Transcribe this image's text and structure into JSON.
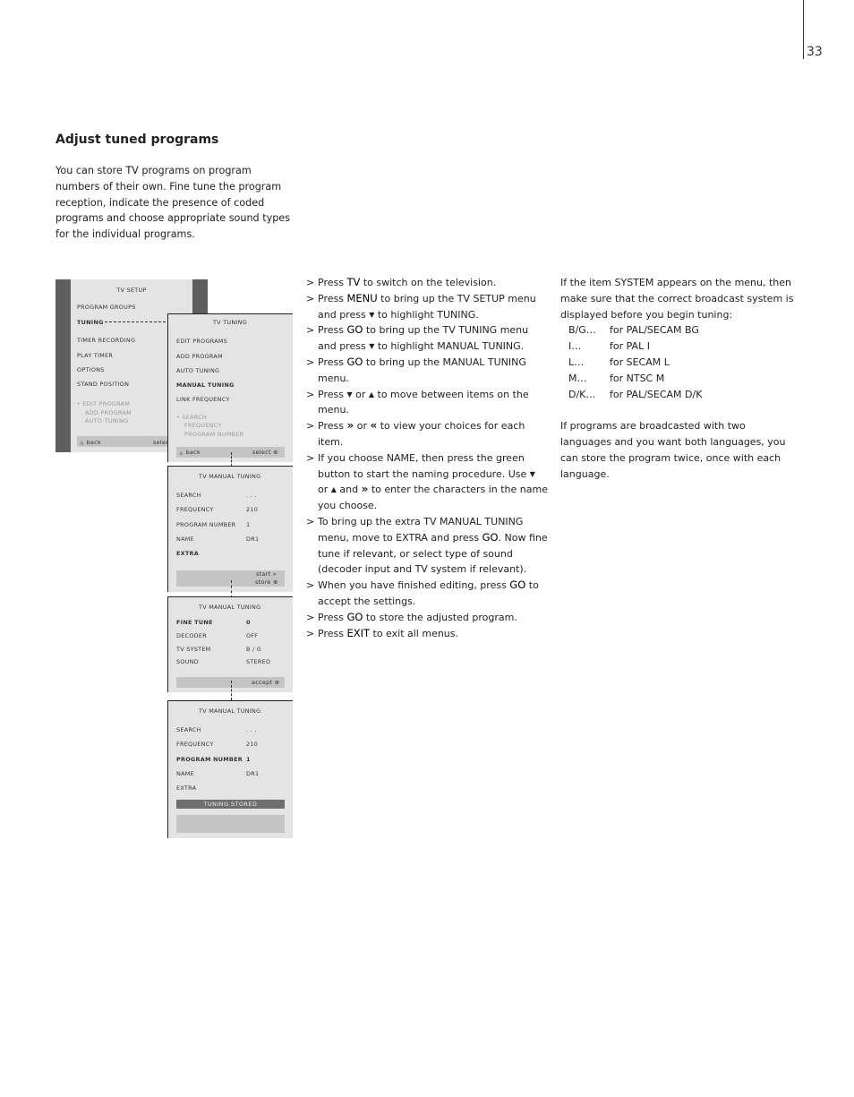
{
  "page_number": "33",
  "title": "Adjust tuned programs",
  "intro": "You can store TV programs on program numbers of their own. Fine tune the program reception, indicate the presence of coded programs and choose appropriate sound types for the individual programs.",
  "steps": [
    [
      {
        "t": "Press "
      },
      {
        "k": "TV"
      },
      {
        "t": " to switch on the television."
      }
    ],
    [
      {
        "t": "Press "
      },
      {
        "k": "MENU"
      },
      {
        "t": " to bring up the TV SETUP menu and press "
      },
      {
        "i": "down"
      },
      {
        "t": " to highlight TUNING."
      }
    ],
    [
      {
        "t": "Press "
      },
      {
        "k": "GO"
      },
      {
        "t": " to bring up the TV TUNING menu and press "
      },
      {
        "i": "down"
      },
      {
        "t": " to highlight MANUAL TUNING."
      }
    ],
    [
      {
        "t": "Press "
      },
      {
        "k": "GO"
      },
      {
        "t": " to bring up the MANUAL TUNING menu."
      }
    ],
    [
      {
        "t": "Press "
      },
      {
        "i": "down"
      },
      {
        "t": " or "
      },
      {
        "i": "up"
      },
      {
        "t": " to move between items on the menu."
      }
    ],
    [
      {
        "t": "Press "
      },
      {
        "i": "ff"
      },
      {
        "t": " or "
      },
      {
        "i": "rew"
      },
      {
        "t": " to view your choices for each item."
      }
    ],
    [
      {
        "t": "If you choose NAME, then press the green button to start the naming procedure. Use "
      },
      {
        "i": "down"
      },
      {
        "t": " or "
      },
      {
        "i": "up"
      },
      {
        "t": " and "
      },
      {
        "i": "ff"
      },
      {
        "t": " to enter the characters in the name you choose."
      }
    ],
    [
      {
        "t": "To bring up the extra TV MANUAL TUNING menu, move to EXTRA and press "
      },
      {
        "k": "GO"
      },
      {
        "t": ". Now fine tune if relevant, or select type of sound (decoder input and TV system if relevant)."
      }
    ],
    [
      {
        "t": "When you have finished editing, press "
      },
      {
        "k": "GO"
      },
      {
        "t": " to accept the settings."
      }
    ],
    [
      {
        "t": "Press "
      },
      {
        "k": "GO"
      },
      {
        "t": " to store the adjusted program."
      }
    ],
    [
      {
        "t": "Press "
      },
      {
        "k": "EXIT"
      },
      {
        "t": " to exit all menus."
      }
    ]
  ],
  "system_note": "If the item SYSTEM appears on the menu, then make sure that the correct broadcast system is displayed before you begin tuning:",
  "systems": [
    [
      "B/G…",
      "for PAL/SECAM BG"
    ],
    [
      "I…",
      "for PAL I"
    ],
    [
      "L…",
      "for SECAM L"
    ],
    [
      "M…",
      "for NTSC M"
    ],
    [
      "D/K…",
      "for PAL/SECAM D/K"
    ]
  ],
  "language_note": "If programs are broadcasted with two languages and you want both languages, you can store the program twice, once with each language.",
  "menus": {
    "setup": {
      "title": "TV SETUP",
      "items": [
        "PROGRAM GROUPS",
        "TUNING",
        "TIMER RECORDING",
        "PLAY TIMER",
        "OPTIONS",
        "STAND POSITION"
      ],
      "hints": [
        "EDIT PROGRAM",
        "ADD PROGRAM",
        "AUTO TUNING"
      ],
      "back": "back",
      "select": "select"
    },
    "tuning": {
      "title": "TV TUNING",
      "items": [
        "EDIT PROGRAMS",
        "ADD PROGRAM",
        "AUTO TUNING",
        "MANUAL TUNING",
        "LINK FREQUENCY"
      ],
      "hints": [
        "SEARCH",
        "FREQUENCY",
        "PROGRAM NUMBER"
      ],
      "back": "back",
      "select": "select"
    },
    "manual": {
      "title": "TV MANUAL TUNING",
      "rows": [
        [
          "SEARCH",
          ". . ."
        ],
        [
          "FREQUENCY",
          "210"
        ],
        [
          "PROGRAM NUMBER",
          "1"
        ],
        [
          "NAME",
          "DR1"
        ],
        [
          "EXTRA",
          ""
        ]
      ],
      "start": "start",
      "store": "store"
    },
    "extra": {
      "title": "TV MANUAL TUNING",
      "rows": [
        [
          "FINE TUNE",
          "0"
        ],
        [
          "DECODER",
          "OFF"
        ],
        [
          "TV SYSTEM",
          "B / G"
        ],
        [
          "SOUND",
          "STEREO"
        ]
      ],
      "accept": "accept"
    },
    "stored": {
      "title": "TV MANUAL TUNING",
      "rows": [
        [
          "SEARCH",
          ". . ."
        ],
        [
          "FREQUENCY",
          "210"
        ],
        [
          "PROGRAM NUMBER",
          "1"
        ],
        [
          "NAME",
          "DR1"
        ],
        [
          "EXTRA",
          ""
        ]
      ],
      "status": "TUNING STORED"
    }
  }
}
